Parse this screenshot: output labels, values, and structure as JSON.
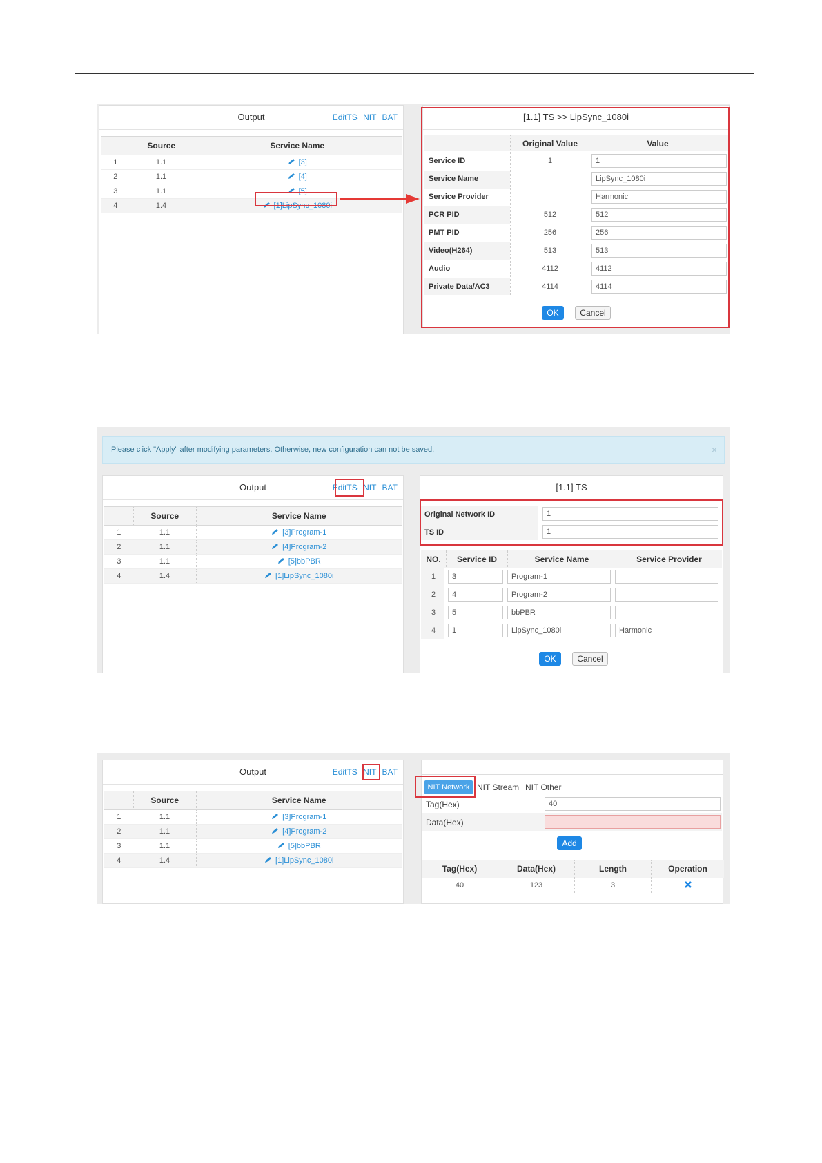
{
  "output": {
    "title": "Output",
    "tab_edit": "EditTS",
    "tab_nit": "NIT",
    "tab_bat": "BAT",
    "col_source": "Source",
    "col_service": "Service Name"
  },
  "shot1": {
    "rows": [
      {
        "no": "1",
        "source": "1.1",
        "service": "[3]"
      },
      {
        "no": "2",
        "source": "1.1",
        "service": "[4]"
      },
      {
        "no": "3",
        "source": "1.1",
        "service": "[5]"
      },
      {
        "no": "4",
        "source": "1.4",
        "service": "[1]LipSync_1080i"
      }
    ],
    "edit": {
      "title": "[1.1] TS >> LipSync_1080i",
      "col_original": "Original Value",
      "col_value": "Value",
      "fields": [
        {
          "label": "Service ID",
          "original": "1",
          "value": "1"
        },
        {
          "label": "Service Name",
          "original": "",
          "value": "LipSync_1080i"
        },
        {
          "label": "Service Provider",
          "original": "",
          "value": "Harmonic"
        },
        {
          "label": "PCR PID",
          "original": "512",
          "value": "512"
        },
        {
          "label": "PMT PID",
          "original": "256",
          "value": "256"
        },
        {
          "label": "Video(H264)",
          "original": "513",
          "value": "513"
        },
        {
          "label": "Audio",
          "original": "4112",
          "value": "4112"
        },
        {
          "label": "Private Data/AC3",
          "original": "4114",
          "value": "4114"
        }
      ],
      "ok": "OK",
      "cancel": "Cancel"
    }
  },
  "shot2": {
    "alert": "Please click \"Apply\" after modifying parameters. Otherwise, new configuration can not be saved.",
    "alert_close": "×",
    "rows": [
      {
        "no": "1",
        "source": "1.1",
        "service": "[3]Program-1"
      },
      {
        "no": "2",
        "source": "1.1",
        "service": "[4]Program-2"
      },
      {
        "no": "3",
        "source": "1.1",
        "service": "[5]bbPBR"
      },
      {
        "no": "4",
        "source": "1.4",
        "service": "[1]LipSync_1080i"
      }
    ],
    "ts": {
      "title": "[1.1] TS",
      "onid_label": "Original Network ID",
      "onid_value": "1",
      "tsid_label": "TS ID",
      "tsid_value": "1",
      "col_no": "NO.",
      "col_sid": "Service ID",
      "col_name": "Service Name",
      "col_provider": "Service Provider",
      "services": [
        {
          "no": "1",
          "sid": "3",
          "name": "Program-1",
          "provider": ""
        },
        {
          "no": "2",
          "sid": "4",
          "name": "Program-2",
          "provider": ""
        },
        {
          "no": "3",
          "sid": "5",
          "name": "bbPBR",
          "provider": ""
        },
        {
          "no": "4",
          "sid": "1",
          "name": "LipSync_1080i",
          "provider": "Harmonic"
        }
      ],
      "ok": "OK",
      "cancel": "Cancel"
    }
  },
  "shot3": {
    "rows": [
      {
        "no": "1",
        "source": "1.1",
        "service": "[3]Program-1"
      },
      {
        "no": "2",
        "source": "1.1",
        "service": "[4]Program-2"
      },
      {
        "no": "3",
        "source": "1.1",
        "service": "[5]bbPBR"
      },
      {
        "no": "4",
        "source": "1.4",
        "service": "[1]LipSync_1080i"
      }
    ],
    "nit": {
      "tab_network": "NIT Network",
      "tab_stream": "NIT Stream",
      "tab_other": "NIT Other",
      "tag_label": "Tag(Hex)",
      "tag_value": "40",
      "data_label": "Data(Hex)",
      "data_value": "",
      "add": "Add",
      "col_tag": "Tag(Hex)",
      "col_data": "Data(Hex)",
      "col_length": "Length",
      "col_operation": "Operation",
      "entries": [
        {
          "tag": "40",
          "data": "123",
          "length": "3"
        }
      ]
    }
  }
}
